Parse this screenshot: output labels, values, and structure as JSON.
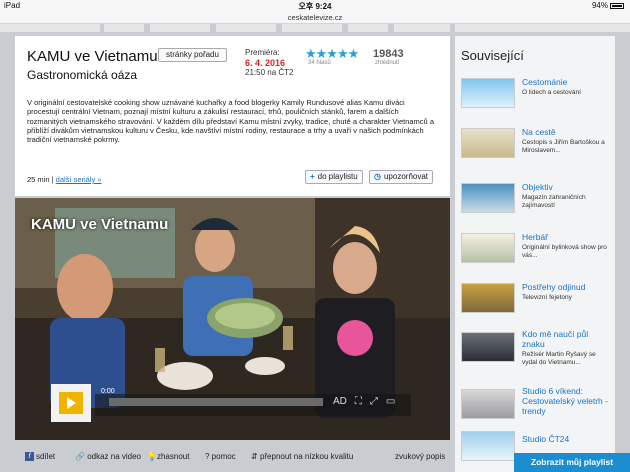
{
  "status": {
    "device": "iPad",
    "time": "오후 9:24",
    "battery": "94%"
  },
  "browser": {
    "url": "ceskatelevize.cz"
  },
  "show": {
    "title": "KAMU ve Vietnamu",
    "subtitle": "Gastronomická oáza",
    "show_pages_button": "stránky pořadu",
    "premiere_label": "Premiéra:",
    "premiere_date": "6. 4. 2016",
    "premiere_time": "21:50 na ČT2",
    "stars": "★★★★★",
    "votes": "34 hlasů",
    "views": "19843",
    "views_label": "zhlédnutí",
    "description": "V originální cestovatelské cooking show uznávané kuchařky a food blogerky Kamily Rundusové alias Kamu diváci procestují centrální Vietnam, poznají místní kulturu a zákulisí restaurací, trhů, pouličních stánků, farem a dalších rozmanitých vietnamského stravování. V každém dílu představí Kamu místní zvyky, tradice, chutě a charakter Vietnamců a přiblíží divákům vietnamskou kulturu v Česku, kde navštíví místní rodiny, restaurace a trhy a uvaří v našich podmínkách tradiční vietnamské pokrmy.",
    "duration": "25 min",
    "separator": "|",
    "more_series": "další seriály »",
    "playlist_button": "do playlistu",
    "notify_button": "upozorňovat"
  },
  "video": {
    "overlay_title": "KAMU ve Vietnamu",
    "time": "0:00",
    "ad_label": "AD"
  },
  "toolbar": {
    "share": "sdílet",
    "link": "odkaz na video",
    "dim": "zhasnout",
    "help": "pomoc",
    "low_quality": "přepnout na nízkou kvalitu",
    "audio_subtitles": "zvukový popis"
  },
  "sidebar": {
    "heading": "Související",
    "items": [
      {
        "title": "Cestománie",
        "desc": "O lidech a cestování"
      },
      {
        "title": "Na cestě",
        "desc": "Cestopis s Jiřím Bartoškou a Miroslavem..."
      },
      {
        "title": "Objektiv",
        "desc": "Magazín zahraničních zajímavostí"
      },
      {
        "title": "Herbář",
        "desc": "Originální bylinková show pro vás..."
      },
      {
        "title": "Postřehy odjinud",
        "desc": "Televizní fejetony"
      },
      {
        "title": "Kdo mě naučí půl znaku",
        "desc": "Režisér Martin Ryšavý se vydal do Vietnamu..."
      },
      {
        "title": "Studio 6 víkend: Cestovatelský veletrh - trendy",
        "desc": ""
      },
      {
        "title": "Studio ČT24",
        "desc": ""
      }
    ],
    "cta": "Zobrazit můj playlist"
  },
  "colors": {
    "accent": "#1a73c8",
    "stars": "#2a9fd8",
    "date": "#dd2222",
    "cta": "#1b8ed1",
    "play": "#f0b400"
  }
}
